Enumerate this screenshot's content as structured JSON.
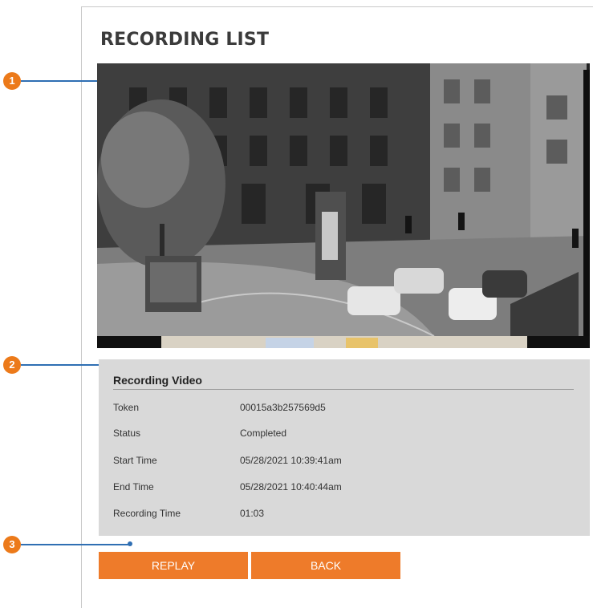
{
  "page": {
    "title": "RECORDING LIST"
  },
  "callouts": [
    "1",
    "2",
    "3"
  ],
  "recording_video": {
    "title": "Recording Video",
    "rows": [
      {
        "label": "Token",
        "value": "00015a3b257569d5"
      },
      {
        "label": "Status",
        "value": "Completed"
      },
      {
        "label": "Start Time",
        "value": "05/28/2021 10:39:41am"
      },
      {
        "label": "End Time",
        "value": "05/28/2021 10:40:44am"
      },
      {
        "label": "Recording Time",
        "value": "01:03"
      }
    ]
  },
  "buttons": {
    "replay": "REPLAY",
    "back": "BACK"
  },
  "colors": {
    "accent": "#ee7b2a",
    "callout": "#ec7a1a",
    "leader_line": "#2f6fb3",
    "panel": "#d9d9d9"
  }
}
